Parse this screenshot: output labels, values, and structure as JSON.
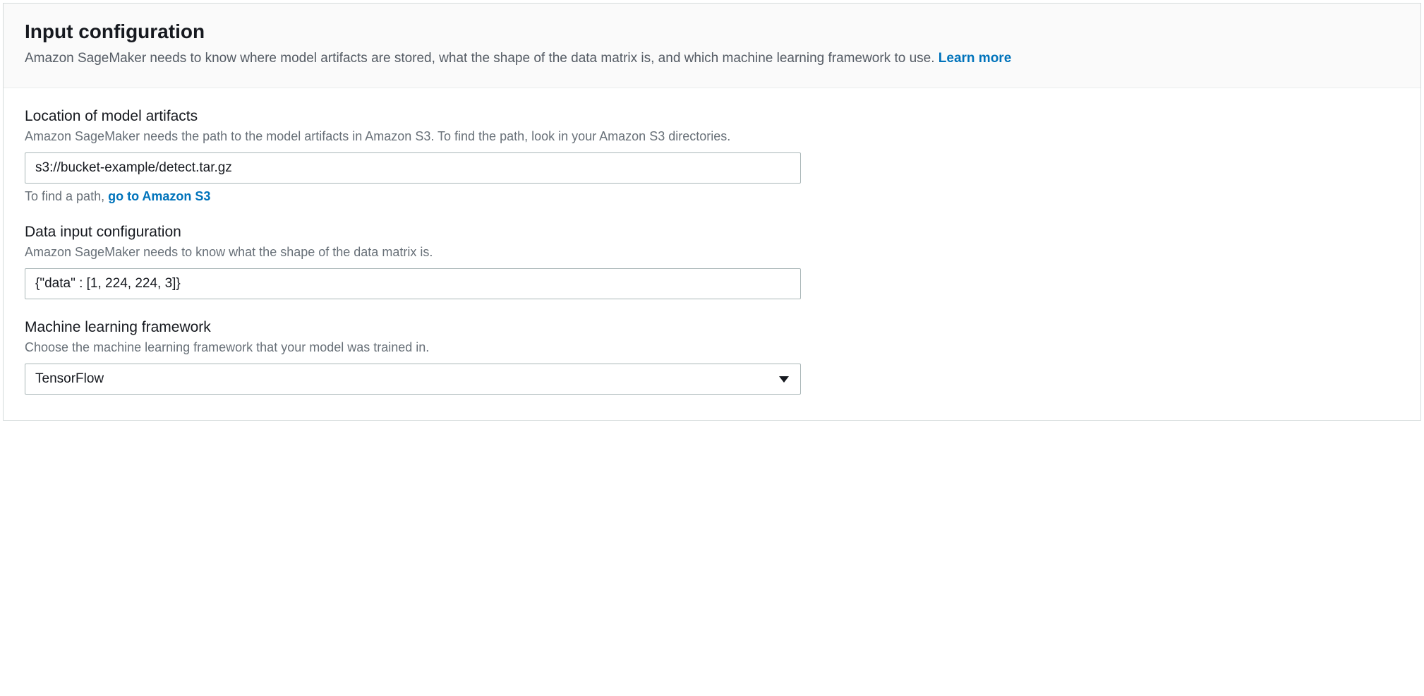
{
  "header": {
    "title": "Input configuration",
    "description": "Amazon SageMaker needs to know where model artifacts are stored, what the shape of the data matrix is, and which machine learning framework to use. ",
    "learn_more": "Learn more"
  },
  "fields": {
    "artifacts": {
      "label": "Location of model artifacts",
      "hint": "Amazon SageMaker needs the path to the model artifacts in Amazon S3. To find the path, look in your Amazon S3 directories.",
      "value": "s3://bucket-example/detect.tar.gz",
      "help_prefix": "To find a path, ",
      "help_link": "go to Amazon S3"
    },
    "data_input": {
      "label": "Data input configuration",
      "hint": "Amazon SageMaker needs to know what the shape of the data matrix is.",
      "value": "{\"data\" : [1, 224, 224, 3]}"
    },
    "framework": {
      "label": "Machine learning framework",
      "hint": "Choose the machine learning framework that your model was trained in.",
      "selected": "TensorFlow"
    }
  }
}
